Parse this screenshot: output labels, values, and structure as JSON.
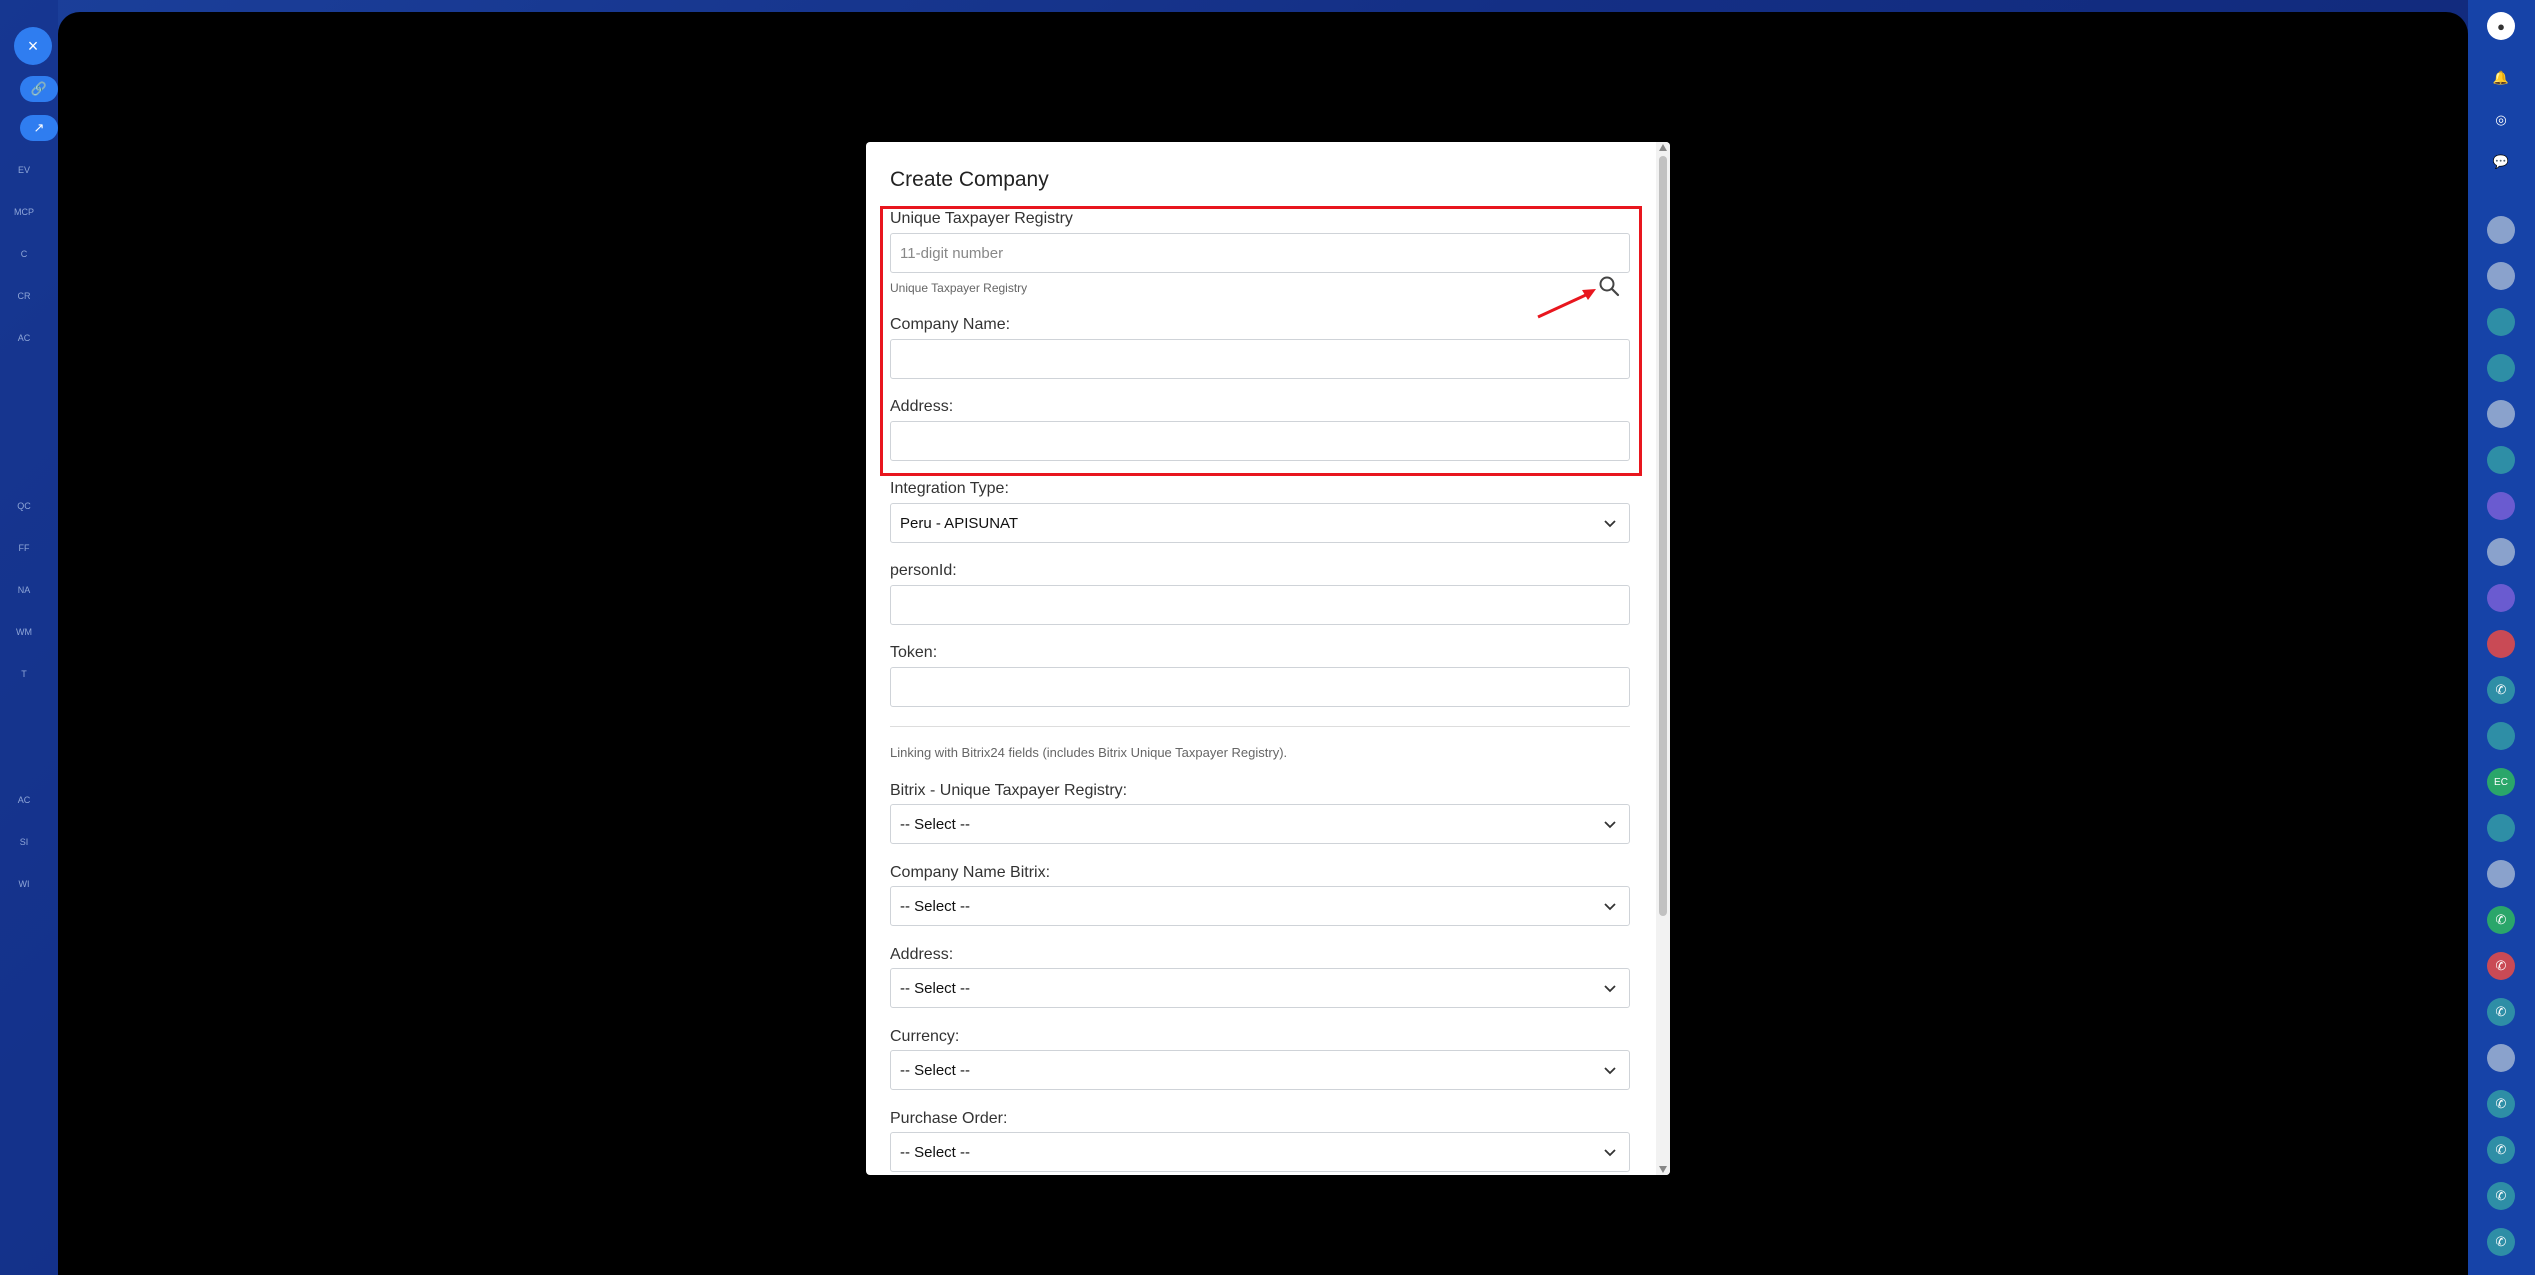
{
  "modal": {
    "title": "Create Company",
    "ruc_label": "Unique Taxpayer Registry",
    "ruc_placeholder": "11-digit number",
    "ruc_help": "Unique Taxpayer Registry",
    "company_name_label": "Company Name:",
    "address_label": "Address:",
    "integration_type_label": "Integration Type:",
    "integration_type_value": "Peru - APISUNAT",
    "person_id_label": "personId:",
    "token_label": "Token:",
    "linking_note": "Linking with Bitrix24 fields (includes Bitrix Unique Taxpayer Registry).",
    "bitrix_ruc_label": "Bitrix - Unique Taxpayer Registry:",
    "bitrix_ruc_value": "-- Select --",
    "company_name_bitrix_label": "Company Name Bitrix:",
    "company_name_bitrix_value": "-- Select --",
    "bitrix_address_label": "Address:",
    "bitrix_address_value": "-- Select --",
    "currency_label": "Currency:",
    "currency_value": "-- Select --",
    "purchase_order_label": "Purchase Order:",
    "purchase_order_value": "-- Select --"
  },
  "left_sidebar": {
    "close_icon": "×",
    "items": [
      "EV",
      "MCP",
      "C",
      "CR",
      "AC",
      "QC",
      "FF",
      "NA",
      "WM",
      "T",
      "AC",
      "SI",
      "WI"
    ]
  },
  "right_sidebar": {
    "ec_badge": "EC"
  },
  "colors": {
    "highlight": "#e8161e",
    "overlay": "#000000",
    "sidebar_blue": "#1643a8",
    "accent": "#2f7df0"
  }
}
